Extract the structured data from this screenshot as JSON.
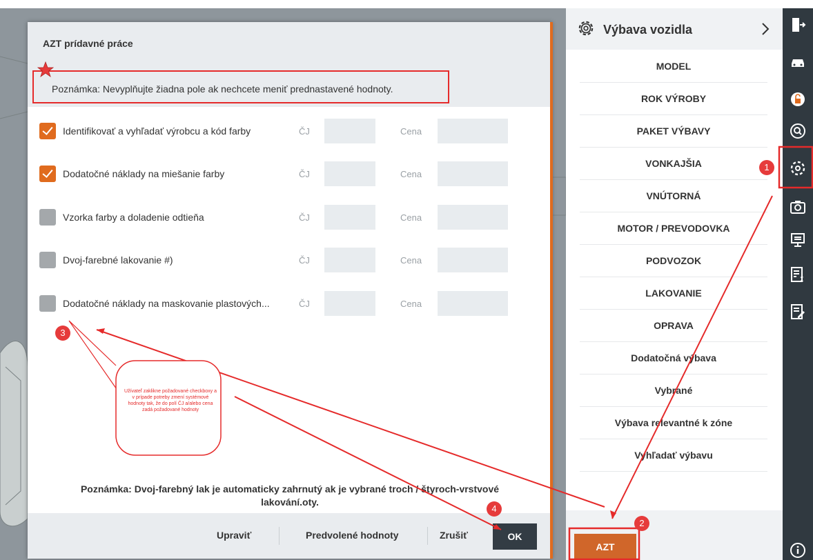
{
  "modal": {
    "title": "AZT prídavné práce",
    "note": "Poznámka: Nevyplňujte žiadna pole ak nechcete meniť prednastavené hodnoty.",
    "cj_label": "ČJ",
    "cena_label": "Cena",
    "rows": [
      {
        "label": "Identifikovať a vyhľadať výrobcu a kód farby",
        "checked": true
      },
      {
        "label": "Dodatočné náklady na miešanie farby",
        "checked": true
      },
      {
        "label": "Vzorka farby a doladenie odtieňa",
        "checked": false
      },
      {
        "label": "Dvoj-farebné lakovanie #)",
        "checked": false
      },
      {
        "label": "Dodatočné náklady na maskovanie plastových...",
        "checked": false
      }
    ],
    "bottom_note": "Poznámka: Dvoj-farebný lak je automaticky zahrnutý ak je vybrané troch / štyroch-vrstvové lakování.oty.",
    "footer": {
      "edit": "Upraviť",
      "defaults": "Predvolené hodnoty",
      "cancel": "Zrušiť",
      "ok": "OK"
    }
  },
  "panel": {
    "title": "Výbava vozidla",
    "items": [
      "MODEL",
      "ROK VÝROBY",
      "PAKET VÝBAVY",
      "VONKAJŠIA",
      "VNÚTORNÁ",
      "MOTOR / PREVODOVKA",
      "PODVOZOK",
      "LAKOVANIE",
      "OPRAVA",
      "Dodatočná výbava",
      "Vybrané",
      "Výbava relevantné k zóne",
      "Vyhľadať výbavu"
    ],
    "azt": "AZT"
  },
  "toolbar": {
    "icons": [
      "exit-icon",
      "car-icon",
      "lock-icon",
      "search-icon",
      "gear-icon",
      "camera-icon",
      "monitor-icon",
      "calculation-icon",
      "edit-document-icon",
      "info-icon"
    ]
  },
  "annotations": {
    "badges": [
      "1",
      "2",
      "3",
      "4"
    ],
    "callout": "Užívateľ zaklikne požadované checkboxy a v prípade potreby zmení systémové hodnoty tak, že do polí ČJ a/alebo cena zadá požadované hodnoty"
  },
  "colors": {
    "accent": "#e06b1e",
    "annotation": "#e52a2a",
    "toolbar": "#303940",
    "ok_button": "#333c44"
  }
}
